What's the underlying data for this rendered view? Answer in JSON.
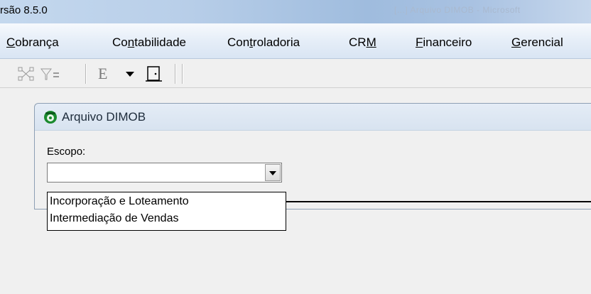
{
  "window": {
    "title": "rsão 8.5.0",
    "ghost_title": "[...] Arquivo DIMOB - Microsoft"
  },
  "menu": [
    {
      "label": "Cobrança"
    },
    {
      "label": "Contabilidade"
    },
    {
      "label": "Controladoria"
    },
    {
      "label": "CRM"
    },
    {
      "label": "Financeiro"
    },
    {
      "label": "Gerencial"
    }
  ],
  "toolbar": {
    "items": [
      {
        "name": "network-nodes-icon"
      },
      {
        "name": "filter-icon"
      },
      {
        "name": "text-style-icon",
        "label": "E"
      },
      {
        "name": "dropdown-arrow-icon"
      },
      {
        "name": "exit-door-icon"
      }
    ]
  },
  "form": {
    "title": "Arquivo DIMOB",
    "escopo_label": "Escopo:",
    "escopo_value": "",
    "options": [
      "Incorporação e Loteamento",
      "Intermediação de Vendas"
    ]
  }
}
